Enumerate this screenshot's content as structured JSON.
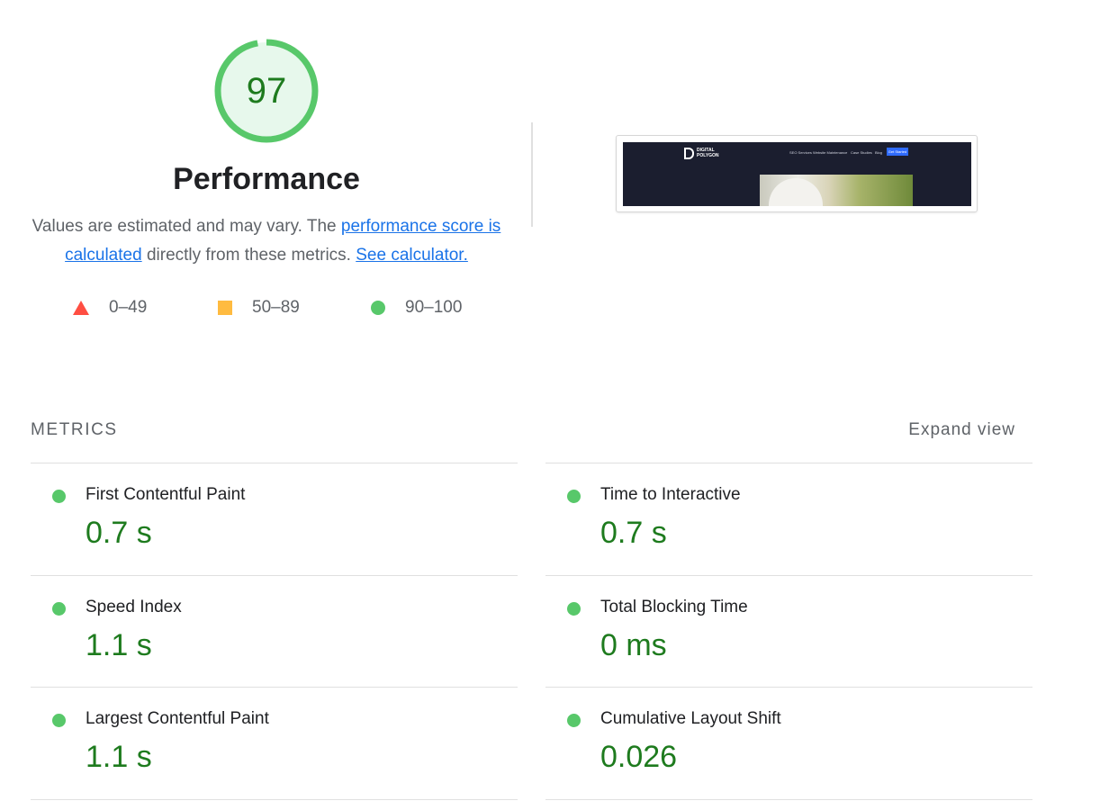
{
  "score": {
    "value": "97",
    "fraction": 0.97,
    "label": "Performance",
    "color": "#0cce6b"
  },
  "description": {
    "prefix": "Values are estimated and may vary. The",
    "link1": "performance score is calculated",
    "middle": "directly from these metrics.",
    "link2": "See calculator."
  },
  "legend": [
    {
      "shape": "triangle-icon",
      "range": "0–49",
      "color": "#ff4e42"
    },
    {
      "shape": "square-icon",
      "range": "50–89",
      "color": "#ffa400"
    },
    {
      "shape": "circle-icon",
      "range": "90–100",
      "color": "#0cce6b"
    }
  ],
  "screenshot": {
    "logo_line1": "DIGITAL",
    "logo_line2": "POLYGON",
    "nav": [
      "SEO Services",
      "Website Maintenance",
      "Case Studies",
      "Blog"
    ],
    "cta": "Get Started"
  },
  "metrics": {
    "title": "Metrics",
    "expand_label": "Expand view",
    "items": [
      {
        "name": "First Contentful Paint",
        "value": "0.7 s"
      },
      {
        "name": "Time to Interactive",
        "value": "0.7 s"
      },
      {
        "name": "Speed Index",
        "value": "1.1 s"
      },
      {
        "name": "Total Blocking Time",
        "value": "0 ms"
      },
      {
        "name": "Largest Contentful Paint",
        "value": "1.1 s"
      },
      {
        "name": "Cumulative Layout Shift",
        "value": "0.026"
      }
    ]
  }
}
